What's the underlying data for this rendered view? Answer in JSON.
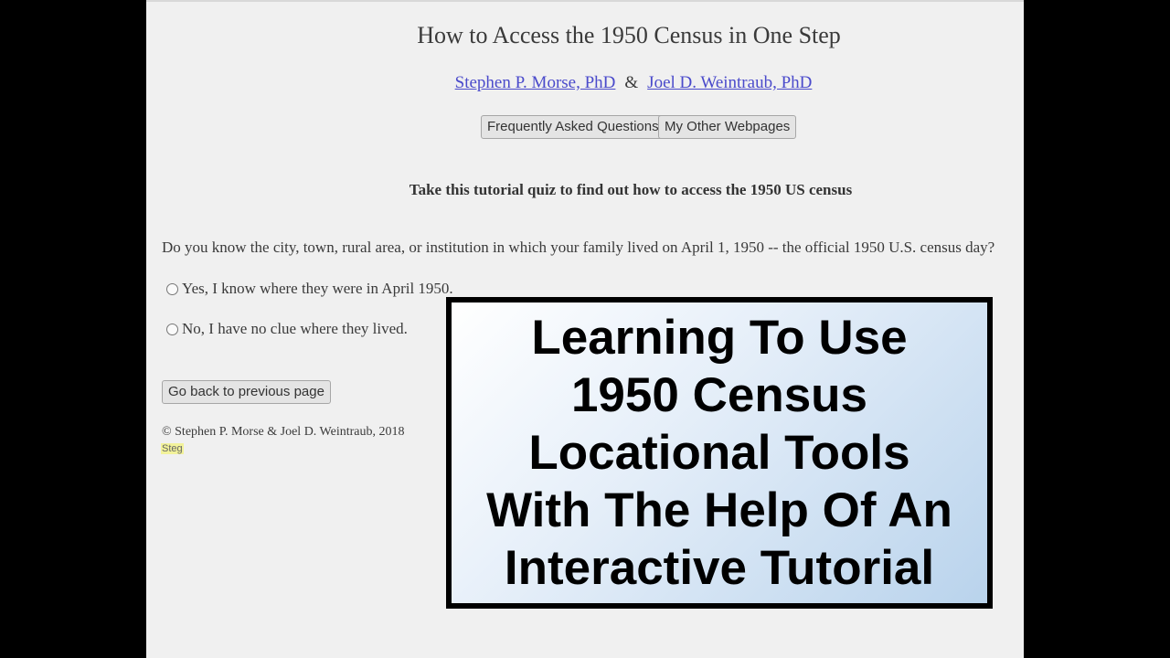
{
  "page": {
    "title": "How to Access the 1950 Census in One Step",
    "authors": [
      "Stephen P. Morse, PhD",
      "Joel D. Weintraub, PhD"
    ],
    "ampersand": "&"
  },
  "buttons": {
    "faq": "Frequently Asked Questions",
    "other": "My Other Webpages",
    "back": "Go back to previous page"
  },
  "quiz": {
    "subtitle": "Take this tutorial quiz to find out how to access the 1950 US census",
    "question": "Do you know the city, town, rural area, or institution in which your family lived on April 1, 1950 -- the official 1950 U.S. census day?",
    "options": [
      "Yes, I know where they were in April 1950.",
      "No, I have no clue where they lived."
    ]
  },
  "footer": {
    "copyright": "© Stephen P. Morse & Joel D. Weintraub, 2018",
    "steg": "Steg"
  },
  "overlay": {
    "lines": [
      "Learning To Use",
      "1950 Census",
      "Locational Tools",
      "With The Help Of An",
      "Interactive Tutorial"
    ]
  }
}
